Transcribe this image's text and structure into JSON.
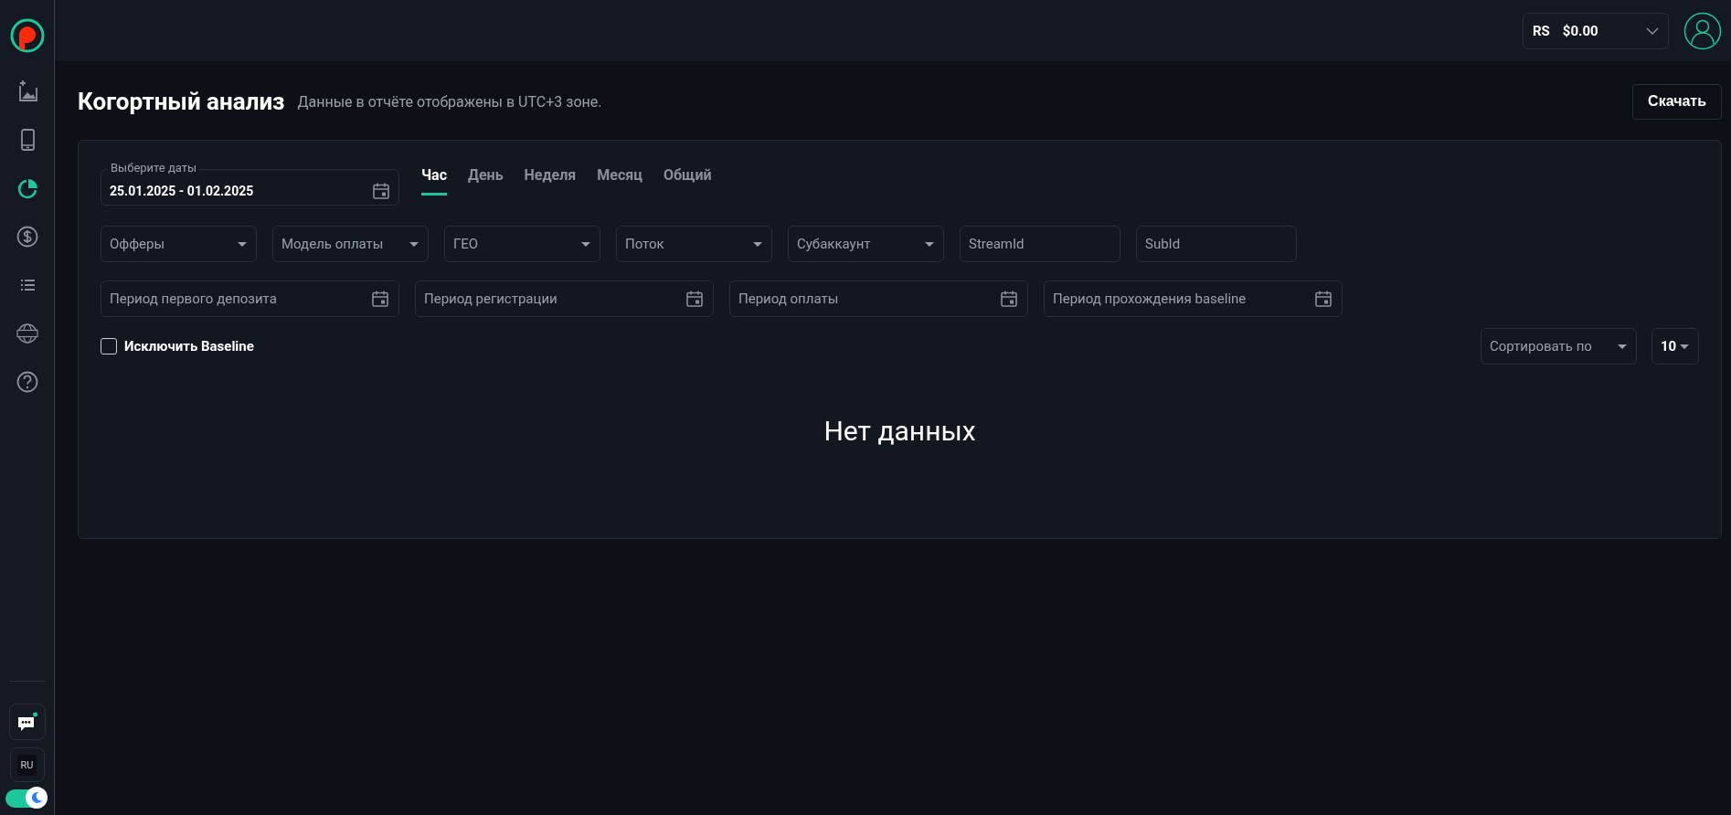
{
  "sidebar": {
    "items": [
      {
        "kind": "add-image",
        "selected": false
      },
      {
        "kind": "phone",
        "selected": false
      },
      {
        "kind": "pie",
        "selected": true
      },
      {
        "kind": "dollar",
        "selected": false
      },
      {
        "kind": "list",
        "selected": false
      },
      {
        "kind": "news",
        "selected": false
      },
      {
        "kind": "help",
        "selected": false
      }
    ],
    "chat": {
      "notification": true
    },
    "language": "RU",
    "dark_mode": {
      "on": true
    }
  },
  "header": {
    "currency": "RS",
    "balance": "$0.00"
  },
  "page": {
    "title": "Когортный анализ",
    "subtitle": "Данные в отчёте отображены в UTC+3 зоне.",
    "download": "Скачать"
  },
  "date_field": {
    "label": "Выберите даты",
    "value": "25.01.2025 - 01.02.2025"
  },
  "tabs": [
    {
      "label": "Час",
      "selected": true
    },
    {
      "label": "День",
      "selected": false
    },
    {
      "label": "Неделя",
      "selected": false
    },
    {
      "label": "Месяц",
      "selected": false
    },
    {
      "label": "Общий",
      "selected": false
    }
  ],
  "filters": [
    {
      "kind": "select",
      "placeholder": "Офферы"
    },
    {
      "kind": "select",
      "placeholder": "Модель оплаты"
    },
    {
      "kind": "select",
      "placeholder": "ГЕО"
    },
    {
      "kind": "select",
      "placeholder": "Поток"
    },
    {
      "kind": "select",
      "placeholder": "Субаккаунт"
    },
    {
      "kind": "text",
      "placeholder": "StreamId"
    },
    {
      "kind": "text",
      "placeholder": "SubId"
    }
  ],
  "periods": [
    {
      "placeholder": "Период первого депозита"
    },
    {
      "placeholder": "Период регистрации"
    },
    {
      "placeholder": "Период оплаты"
    },
    {
      "placeholder": "Период прохождения baseline"
    }
  ],
  "exclude_baseline": {
    "label": "Исключить Baseline",
    "checked": false
  },
  "sort": {
    "placeholder": "Сортировать по"
  },
  "page_size": {
    "value": "10"
  },
  "empty_message": "Нет данных"
}
